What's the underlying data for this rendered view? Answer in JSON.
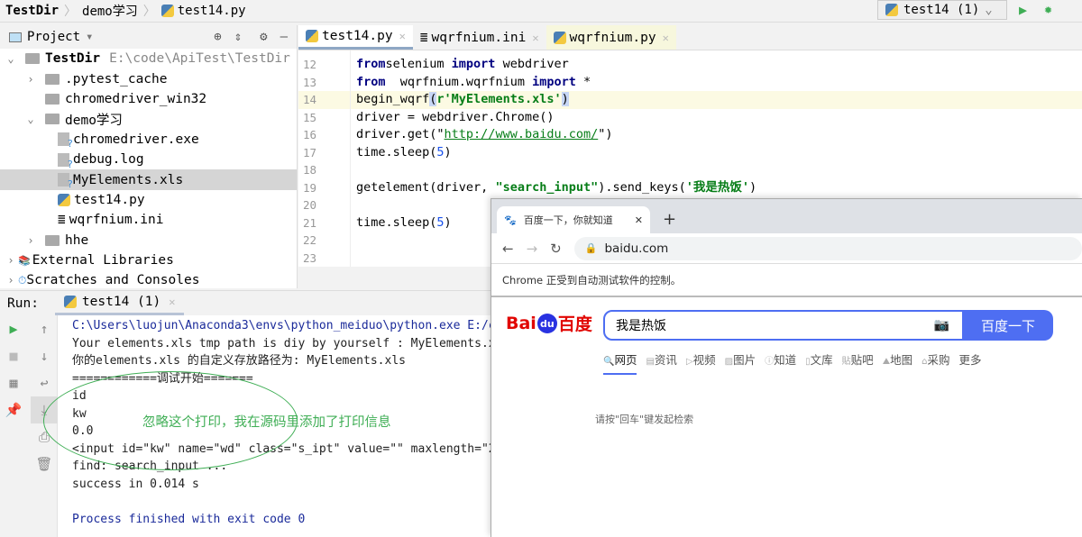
{
  "breadcrumb": [
    "TestDir",
    "demo学习",
    "test14.py"
  ],
  "run_config": {
    "label": "test14 (1)"
  },
  "project": {
    "title": "Project",
    "tree": [
      {
        "label": "TestDir",
        "extra": "E:\\code\\ApiTest\\TestDir",
        "level": 0,
        "kind": "folder",
        "chev": "v",
        "bold": true
      },
      {
        "label": ".pytest_cache",
        "level": 1,
        "kind": "folder",
        "chev": ">"
      },
      {
        "label": "chromedriver_win32",
        "level": 1,
        "kind": "folder",
        "chev": ""
      },
      {
        "label": "demo学习",
        "level": 1,
        "kind": "folder",
        "chev": "v"
      },
      {
        "label": "chromedriver.exe",
        "level": 2,
        "kind": "unknown",
        "chev": ""
      },
      {
        "label": "debug.log",
        "level": 2,
        "kind": "unknown",
        "chev": ""
      },
      {
        "label": "MyElements.xls",
        "level": 2,
        "kind": "unknown",
        "chev": "",
        "selected": true
      },
      {
        "label": "test14.py",
        "level": 2,
        "kind": "python",
        "chev": ""
      },
      {
        "label": "wqrfnium.ini",
        "level": 2,
        "kind": "ini",
        "chev": ""
      },
      {
        "label": "hhe",
        "level": 1,
        "kind": "folder",
        "chev": ">"
      },
      {
        "label": "External Libraries",
        "level": 0,
        "kind": "lib",
        "chev": ">"
      },
      {
        "label": "Scratches and Consoles",
        "level": 0,
        "kind": "scratch",
        "chev": ">"
      }
    ]
  },
  "editor": {
    "tabs": [
      {
        "label": "test14.py",
        "icon": "python",
        "active": true
      },
      {
        "label": "wqrfnium.ini",
        "icon": "ini"
      },
      {
        "label": "wqrfnium.py",
        "icon": "python",
        "highlighted": true
      }
    ],
    "line_numbers": [
      "12",
      "13",
      "14",
      "15",
      "16",
      "17",
      "18",
      "19",
      "20",
      "21",
      "22",
      "23"
    ],
    "current_line": "14",
    "code": [
      [
        [
          "kw",
          "from"
        ],
        [
          "",
          "selenium "
        ],
        [
          "kw",
          "import"
        ],
        [
          "",
          " webdriver"
        ]
      ],
      [
        [
          "kw",
          "from"
        ],
        [
          "",
          "",
          " "
        ],
        [
          "",
          " wqrfnium.wqrfnium "
        ],
        [
          "kw",
          "import"
        ],
        [
          "",
          " *"
        ]
      ],
      [
        [
          "",
          "begin_wqrf"
        ],
        [
          "br",
          "("
        ],
        [
          "str",
          "r'MyElements.xls'"
        ],
        [
          "br",
          ")"
        ]
      ],
      [
        [
          "",
          "driver = webdriver.Chrome()"
        ]
      ],
      [
        [
          "",
          "driver.get(\""
        ],
        [
          "url",
          "http://www.baidu.com/"
        ],
        [
          "",
          "\")"
        ]
      ],
      [
        [
          "",
          "time.sleep("
        ],
        [
          "num",
          "5"
        ],
        [
          "",
          ")"
        ]
      ],
      [],
      [
        [
          "",
          "getelement(driver, "
        ],
        [
          "str",
          "\"search_input\""
        ],
        [
          "",
          ").send_keys("
        ],
        [
          "str",
          "'我是热饭'"
        ],
        [
          "",
          ")"
        ]
      ],
      [],
      [
        [
          "",
          "time.sleep("
        ],
        [
          "num",
          "5"
        ],
        [
          "",
          ")"
        ]
      ],
      [],
      []
    ]
  },
  "run": {
    "label": "Run:",
    "tab": "test14 (1)",
    "output": [
      "C:\\Users\\luojun\\Anaconda3\\envs\\python_meiduo\\python.exe E:/c",
      "Your elements.xls tmp path is diy by yourself : MyElements.x",
      "你的elements.xls 的自定义存放路径为: MyElements.xls",
      "============调试开始=======",
      "id",
      "kw",
      "0.0",
      "<input id=\"kw\" name=\"wd\" class=\"s_ipt\" value=\"\" maxlength=\"2",
      "find: search_input ...",
      "success in 0.014 s",
      "",
      "Process finished with exit code 0"
    ],
    "annotation": "忽略这个打印，我在源码里添加了打印信息"
  },
  "browser": {
    "tab_title": "百度一下，你就知道",
    "url": "baidu.com",
    "infobar": "Chrome 正受到自动测试软件的控制。",
    "logo": "Bai du 百度",
    "search_value": "我是热饭",
    "search_button": "百度一下",
    "nav": [
      "网页",
      "资讯",
      "视频",
      "图片",
      "知道",
      "文库",
      "贴吧",
      "地图",
      "采购",
      "更多"
    ],
    "hint": "请按\"回车\"键发起检索"
  },
  "colors": {
    "accent": "#4e6ef2",
    "run_green": "#3fae55",
    "keyword": "#000080",
    "string": "#067d17"
  }
}
